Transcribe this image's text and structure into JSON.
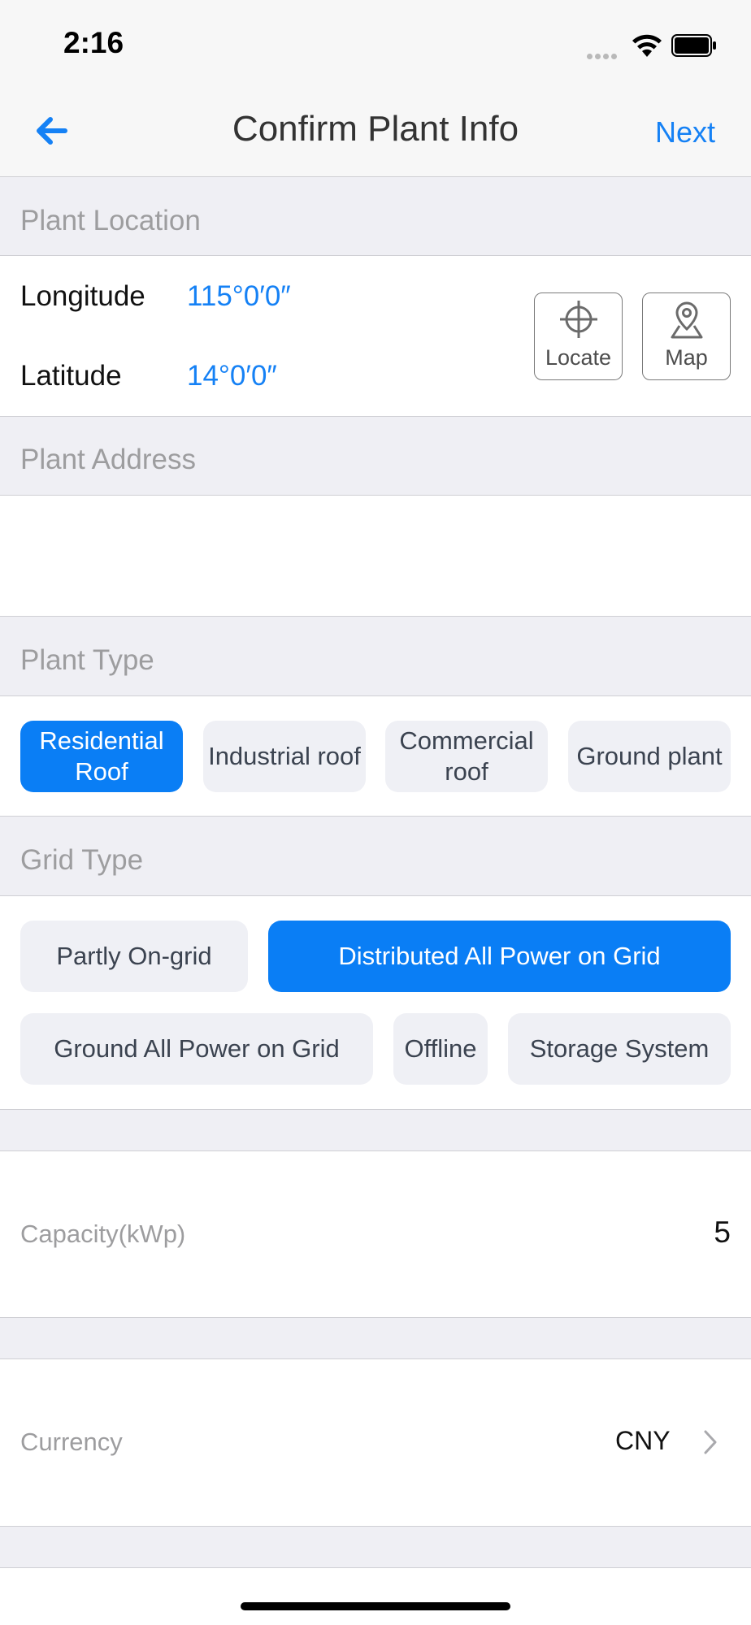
{
  "status_bar": {
    "time": "2:16"
  },
  "nav": {
    "title": "Confirm Plant Info",
    "next_label": "Next"
  },
  "location": {
    "header": "Plant Location",
    "longitude_label": "Longitude",
    "longitude_value": "115°0′0″",
    "latitude_label": "Latitude",
    "latitude_value": "14°0′0″",
    "locate_label": "Locate",
    "map_label": "Map"
  },
  "address": {
    "header": "Plant Address",
    "value": ""
  },
  "plant_type": {
    "header": "Plant Type",
    "options": [
      "Residential Roof",
      "Industrial roof",
      "Commercial roof",
      "Ground plant"
    ],
    "selected": "Residential Roof"
  },
  "grid_type": {
    "header": "Grid Type",
    "options": [
      "Partly On-grid",
      "Distributed All Power on Grid",
      "Ground All Power on Grid",
      "Offline",
      "Storage System"
    ],
    "selected": "Distributed All Power on Grid"
  },
  "capacity": {
    "label": "Capacity(kWp)",
    "value": "5"
  },
  "currency": {
    "label": "Currency",
    "value": "CNY"
  },
  "colors": {
    "accent": "#1581f5",
    "selected_chip": "#0a7ef5",
    "section_bg": "#efeff4"
  }
}
